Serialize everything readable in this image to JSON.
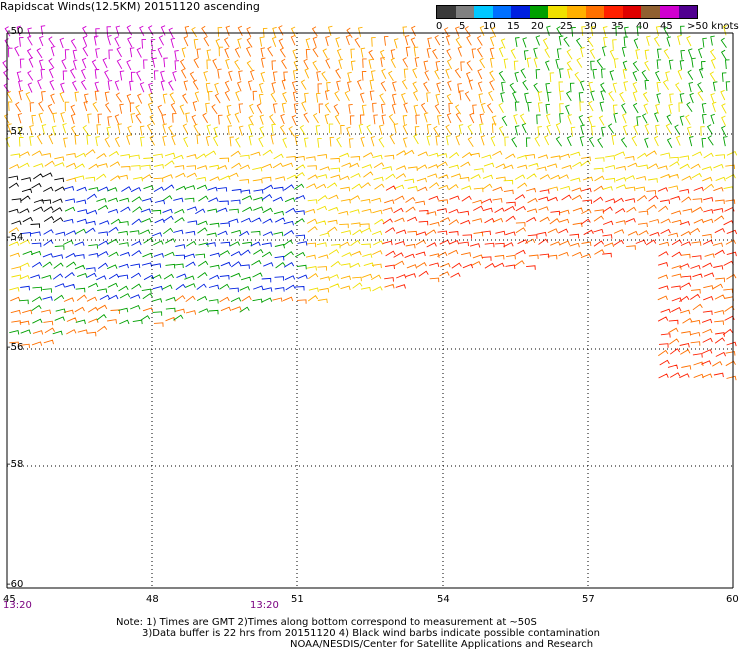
{
  "title": "Rapidscat Winds(12.5KM) 20151120 ascending",
  "legend": {
    "colors": [
      "#3a3a3a",
      "#808080",
      "#00c8ff",
      "#0070ff",
      "#0020e0",
      "#00a000",
      "#f0e000",
      "#ffb000",
      "#ff7000",
      "#ff2000",
      "#e00000",
      "#906030",
      "#d000d0",
      "#500090"
    ],
    "ticks": [
      "0",
      "5",
      "10",
      "15",
      "20",
      "25",
      "30",
      "35",
      "40",
      "45",
      ">50 knots"
    ]
  },
  "lat_labels": [
    "-50",
    "-52",
    "-54",
    "-56",
    "-58",
    "-60"
  ],
  "lon_labels": [
    "45",
    "48",
    "51",
    "54",
    "57",
    "60"
  ],
  "times": [
    "13:20",
    "13:20"
  ],
  "notes": [
    "Note: 1) Times are GMT 2)Times along bottom correspond to measurement at ~50S",
    "3)Data buffer is 22 hrs from 20151120 4) Black wind barbs indicate possible contamination",
    "NOAA/NESDIS/Center for Satellite Applications and Research"
  ]
}
